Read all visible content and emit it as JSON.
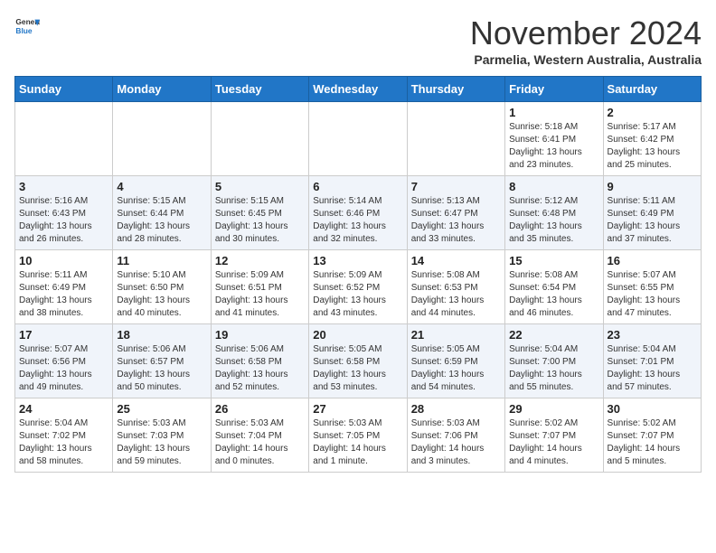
{
  "logo": {
    "line1": "General",
    "line2": "Blue"
  },
  "title": "November 2024",
  "location": "Parmelia, Western Australia, Australia",
  "days_header": [
    "Sunday",
    "Monday",
    "Tuesday",
    "Wednesday",
    "Thursday",
    "Friday",
    "Saturday"
  ],
  "weeks": [
    [
      {
        "day": "",
        "info": ""
      },
      {
        "day": "",
        "info": ""
      },
      {
        "day": "",
        "info": ""
      },
      {
        "day": "",
        "info": ""
      },
      {
        "day": "",
        "info": ""
      },
      {
        "day": "1",
        "info": "Sunrise: 5:18 AM\nSunset: 6:41 PM\nDaylight: 13 hours\nand 23 minutes."
      },
      {
        "day": "2",
        "info": "Sunrise: 5:17 AM\nSunset: 6:42 PM\nDaylight: 13 hours\nand 25 minutes."
      }
    ],
    [
      {
        "day": "3",
        "info": "Sunrise: 5:16 AM\nSunset: 6:43 PM\nDaylight: 13 hours\nand 26 minutes."
      },
      {
        "day": "4",
        "info": "Sunrise: 5:15 AM\nSunset: 6:44 PM\nDaylight: 13 hours\nand 28 minutes."
      },
      {
        "day": "5",
        "info": "Sunrise: 5:15 AM\nSunset: 6:45 PM\nDaylight: 13 hours\nand 30 minutes."
      },
      {
        "day": "6",
        "info": "Sunrise: 5:14 AM\nSunset: 6:46 PM\nDaylight: 13 hours\nand 32 minutes."
      },
      {
        "day": "7",
        "info": "Sunrise: 5:13 AM\nSunset: 6:47 PM\nDaylight: 13 hours\nand 33 minutes."
      },
      {
        "day": "8",
        "info": "Sunrise: 5:12 AM\nSunset: 6:48 PM\nDaylight: 13 hours\nand 35 minutes."
      },
      {
        "day": "9",
        "info": "Sunrise: 5:11 AM\nSunset: 6:49 PM\nDaylight: 13 hours\nand 37 minutes."
      }
    ],
    [
      {
        "day": "10",
        "info": "Sunrise: 5:11 AM\nSunset: 6:49 PM\nDaylight: 13 hours\nand 38 minutes."
      },
      {
        "day": "11",
        "info": "Sunrise: 5:10 AM\nSunset: 6:50 PM\nDaylight: 13 hours\nand 40 minutes."
      },
      {
        "day": "12",
        "info": "Sunrise: 5:09 AM\nSunset: 6:51 PM\nDaylight: 13 hours\nand 41 minutes."
      },
      {
        "day": "13",
        "info": "Sunrise: 5:09 AM\nSunset: 6:52 PM\nDaylight: 13 hours\nand 43 minutes."
      },
      {
        "day": "14",
        "info": "Sunrise: 5:08 AM\nSunset: 6:53 PM\nDaylight: 13 hours\nand 44 minutes."
      },
      {
        "day": "15",
        "info": "Sunrise: 5:08 AM\nSunset: 6:54 PM\nDaylight: 13 hours\nand 46 minutes."
      },
      {
        "day": "16",
        "info": "Sunrise: 5:07 AM\nSunset: 6:55 PM\nDaylight: 13 hours\nand 47 minutes."
      }
    ],
    [
      {
        "day": "17",
        "info": "Sunrise: 5:07 AM\nSunset: 6:56 PM\nDaylight: 13 hours\nand 49 minutes."
      },
      {
        "day": "18",
        "info": "Sunrise: 5:06 AM\nSunset: 6:57 PM\nDaylight: 13 hours\nand 50 minutes."
      },
      {
        "day": "19",
        "info": "Sunrise: 5:06 AM\nSunset: 6:58 PM\nDaylight: 13 hours\nand 52 minutes."
      },
      {
        "day": "20",
        "info": "Sunrise: 5:05 AM\nSunset: 6:58 PM\nDaylight: 13 hours\nand 53 minutes."
      },
      {
        "day": "21",
        "info": "Sunrise: 5:05 AM\nSunset: 6:59 PM\nDaylight: 13 hours\nand 54 minutes."
      },
      {
        "day": "22",
        "info": "Sunrise: 5:04 AM\nSunset: 7:00 PM\nDaylight: 13 hours\nand 55 minutes."
      },
      {
        "day": "23",
        "info": "Sunrise: 5:04 AM\nSunset: 7:01 PM\nDaylight: 13 hours\nand 57 minutes."
      }
    ],
    [
      {
        "day": "24",
        "info": "Sunrise: 5:04 AM\nSunset: 7:02 PM\nDaylight: 13 hours\nand 58 minutes."
      },
      {
        "day": "25",
        "info": "Sunrise: 5:03 AM\nSunset: 7:03 PM\nDaylight: 13 hours\nand 59 minutes."
      },
      {
        "day": "26",
        "info": "Sunrise: 5:03 AM\nSunset: 7:04 PM\nDaylight: 14 hours\nand 0 minutes."
      },
      {
        "day": "27",
        "info": "Sunrise: 5:03 AM\nSunset: 7:05 PM\nDaylight: 14 hours\nand 1 minute."
      },
      {
        "day": "28",
        "info": "Sunrise: 5:03 AM\nSunset: 7:06 PM\nDaylight: 14 hours\nand 3 minutes."
      },
      {
        "day": "29",
        "info": "Sunrise: 5:02 AM\nSunset: 7:07 PM\nDaylight: 14 hours\nand 4 minutes."
      },
      {
        "day": "30",
        "info": "Sunrise: 5:02 AM\nSunset: 7:07 PM\nDaylight: 14 hours\nand 5 minutes."
      }
    ]
  ]
}
